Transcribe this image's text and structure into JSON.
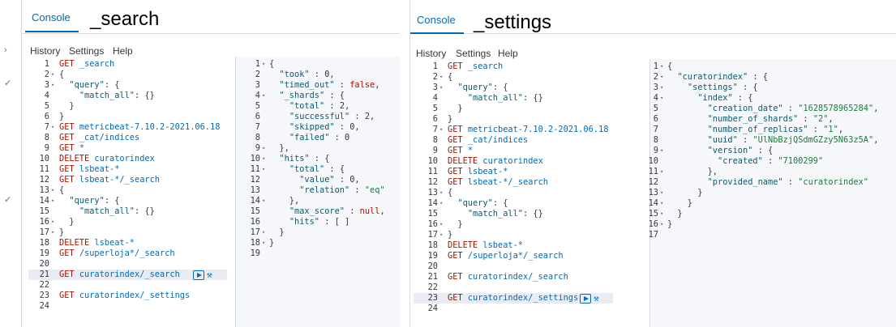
{
  "left": {
    "tab": "Console",
    "heading": "_search",
    "menu": [
      "History",
      "Settings",
      "Help"
    ],
    "request_lines": [
      [
        [
          "kw",
          "GET "
        ],
        [
          "path",
          "_search"
        ]
      ],
      [
        [
          "pun",
          "{"
        ]
      ],
      [
        [
          "pun",
          "  "
        ],
        [
          "key",
          "\"query\""
        ],
        [
          "pun",
          ": {"
        ]
      ],
      [
        [
          "pun",
          "    "
        ],
        [
          "key",
          "\"match_all\""
        ],
        [
          "pun",
          ": {}"
        ]
      ],
      [
        [
          "pun",
          "  }"
        ]
      ],
      [
        [
          "pun",
          "}"
        ]
      ],
      [
        [
          "kw",
          "GET "
        ],
        [
          "path",
          "metricbeat-7.10.2-2021.06.18"
        ]
      ],
      [
        [
          "kw",
          "GET "
        ],
        [
          "path",
          "_cat/indices"
        ]
      ],
      [
        [
          "kw",
          "GET "
        ],
        [
          "path",
          "*"
        ]
      ],
      [
        [
          "kw",
          "DELETE "
        ],
        [
          "path",
          "curatorindex"
        ]
      ],
      [
        [
          "kw",
          "GET "
        ],
        [
          "path",
          "lsbeat-*"
        ]
      ],
      [
        [
          "kw",
          "GET "
        ],
        [
          "path",
          "lsbeat-*/_search"
        ]
      ],
      [
        [
          "pun",
          "{"
        ]
      ],
      [
        [
          "pun",
          "  "
        ],
        [
          "key",
          "\"query\""
        ],
        [
          "pun",
          ": {"
        ]
      ],
      [
        [
          "pun",
          "    "
        ],
        [
          "key",
          "\"match_all\""
        ],
        [
          "pun",
          ": {}"
        ]
      ],
      [
        [
          "pun",
          "  }"
        ]
      ],
      [
        [
          "pun",
          "}"
        ]
      ],
      [
        [
          "kw",
          "DELETE "
        ],
        [
          "path",
          "lsbeat-*"
        ]
      ],
      [
        [
          "kw",
          "GET "
        ],
        [
          "path",
          "/superloja*/_search"
        ]
      ],
      [],
      [
        [
          "kw",
          "GET "
        ],
        [
          "path",
          "curatorindex/_search"
        ]
      ],
      [],
      [
        [
          "kw",
          "GET "
        ],
        [
          "path",
          "curatorindex/_settings"
        ]
      ],
      []
    ],
    "request_folds": [
      2,
      3,
      7,
      13,
      14,
      16,
      17
    ],
    "response_lines": [
      [
        [
          "pun",
          "{"
        ]
      ],
      [
        [
          "pun",
          "  "
        ],
        [
          "key",
          "\"took\""
        ],
        [
          "pun",
          " : "
        ],
        [
          "num",
          "0"
        ],
        [
          "pun",
          ","
        ]
      ],
      [
        [
          "pun",
          "  "
        ],
        [
          "key",
          "\"timed_out\""
        ],
        [
          "pun",
          " : "
        ],
        [
          "bool",
          "false"
        ],
        [
          "pun",
          ","
        ]
      ],
      [
        [
          "pun",
          "  "
        ],
        [
          "key",
          "\"_shards\""
        ],
        [
          "pun",
          " : {"
        ]
      ],
      [
        [
          "pun",
          "    "
        ],
        [
          "key",
          "\"total\""
        ],
        [
          "pun",
          " : "
        ],
        [
          "num",
          "2"
        ],
        [
          "pun",
          ","
        ]
      ],
      [
        [
          "pun",
          "    "
        ],
        [
          "key",
          "\"successful\""
        ],
        [
          "pun",
          " : "
        ],
        [
          "num",
          "2"
        ],
        [
          "pun",
          ","
        ]
      ],
      [
        [
          "pun",
          "    "
        ],
        [
          "key",
          "\"skipped\""
        ],
        [
          "pun",
          " : "
        ],
        [
          "num",
          "0"
        ],
        [
          "pun",
          ","
        ]
      ],
      [
        [
          "pun",
          "    "
        ],
        [
          "key",
          "\"failed\""
        ],
        [
          "pun",
          " : "
        ],
        [
          "num",
          "0"
        ]
      ],
      [
        [
          "pun",
          "  },"
        ]
      ],
      [
        [
          "pun",
          "  "
        ],
        [
          "key",
          "\"hits\""
        ],
        [
          "pun",
          " : {"
        ]
      ],
      [
        [
          "pun",
          "    "
        ],
        [
          "key",
          "\"total\""
        ],
        [
          "pun",
          " : {"
        ]
      ],
      [
        [
          "pun",
          "      "
        ],
        [
          "key",
          "\"value\""
        ],
        [
          "pun",
          " : "
        ],
        [
          "num",
          "0"
        ],
        [
          "pun",
          ","
        ]
      ],
      [
        [
          "pun",
          "      "
        ],
        [
          "key",
          "\"relation\""
        ],
        [
          "pun",
          " : "
        ],
        [
          "str",
          "\"eq\""
        ]
      ],
      [
        [
          "pun",
          "    },"
        ]
      ],
      [
        [
          "pun",
          "    "
        ],
        [
          "key",
          "\"max_score\""
        ],
        [
          "pun",
          " : "
        ],
        [
          "bool",
          "null"
        ],
        [
          "pun",
          ","
        ]
      ],
      [
        [
          "pun",
          "    "
        ],
        [
          "key",
          "\"hits\""
        ],
        [
          "pun",
          " : [ ]"
        ]
      ],
      [
        [
          "pun",
          "  }"
        ]
      ],
      [
        [
          "pun",
          "}"
        ]
      ],
      []
    ],
    "response_folds": [
      1,
      4,
      9,
      10,
      11,
      14,
      17,
      18
    ],
    "active_line": 21
  },
  "right": {
    "tab": "Console",
    "heading": "_settings",
    "menu": [
      "History",
      "Settings",
      "Help"
    ],
    "request_lines": [
      [
        [
          "kw",
          "GET "
        ],
        [
          "path",
          "_search"
        ]
      ],
      [
        [
          "pun",
          "{"
        ]
      ],
      [
        [
          "pun",
          "  "
        ],
        [
          "key",
          "\"query\""
        ],
        [
          "pun",
          ": {"
        ]
      ],
      [
        [
          "pun",
          "    "
        ],
        [
          "key",
          "\"match_all\""
        ],
        [
          "pun",
          ": {}"
        ]
      ],
      [
        [
          "pun",
          "  }"
        ]
      ],
      [
        [
          "pun",
          "}"
        ]
      ],
      [
        [
          "kw",
          "GET "
        ],
        [
          "path",
          "metricbeat-7.10.2-2021.06.18"
        ]
      ],
      [
        [
          "kw",
          "GET "
        ],
        [
          "path",
          "_cat/indices"
        ]
      ],
      [
        [
          "kw",
          "GET "
        ],
        [
          "path",
          "*"
        ]
      ],
      [
        [
          "kw",
          "DELETE "
        ],
        [
          "path",
          "curatorindex"
        ]
      ],
      [
        [
          "kw",
          "GET "
        ],
        [
          "path",
          "lsbeat-*"
        ]
      ],
      [
        [
          "kw",
          "GET "
        ],
        [
          "path",
          "lsbeat-*/_search"
        ]
      ],
      [
        [
          "pun",
          "{"
        ]
      ],
      [
        [
          "pun",
          "  "
        ],
        [
          "key",
          "\"query\""
        ],
        [
          "pun",
          ": {"
        ]
      ],
      [
        [
          "pun",
          "    "
        ],
        [
          "key",
          "\"match_all\""
        ],
        [
          "pun",
          ": {}"
        ]
      ],
      [
        [
          "pun",
          "  }"
        ]
      ],
      [
        [
          "pun",
          "}"
        ]
      ],
      [
        [
          "kw",
          "DELETE "
        ],
        [
          "path",
          "lsbeat-*"
        ]
      ],
      [
        [
          "kw",
          "GET "
        ],
        [
          "path",
          "/superloja*/_search"
        ]
      ],
      [],
      [
        [
          "kw",
          "GET "
        ],
        [
          "path",
          "curatorindex/_search"
        ]
      ],
      [],
      [
        [
          "kw",
          "GET "
        ],
        [
          "path",
          "curatorindex/_settings"
        ]
      ],
      []
    ],
    "request_folds": [
      2,
      3,
      7,
      13,
      14,
      16,
      17
    ],
    "response_lines": [
      [
        [
          "pun",
          "{"
        ]
      ],
      [
        [
          "pun",
          "  "
        ],
        [
          "key",
          "\"curatorindex\""
        ],
        [
          "pun",
          " : {"
        ]
      ],
      [
        [
          "pun",
          "    "
        ],
        [
          "key",
          "\"settings\""
        ],
        [
          "pun",
          " : {"
        ]
      ],
      [
        [
          "pun",
          "      "
        ],
        [
          "key",
          "\"index\""
        ],
        [
          "pun",
          " : {"
        ]
      ],
      [
        [
          "pun",
          "        "
        ],
        [
          "key",
          "\"creation_date\""
        ],
        [
          "pun",
          " : "
        ],
        [
          "str",
          "\"1628578965284\""
        ],
        [
          "pun",
          ","
        ]
      ],
      [
        [
          "pun",
          "        "
        ],
        [
          "key",
          "\"number_of_shards\""
        ],
        [
          "pun",
          " : "
        ],
        [
          "str",
          "\"2\""
        ],
        [
          "pun",
          ","
        ]
      ],
      [
        [
          "pun",
          "        "
        ],
        [
          "key",
          "\"number_of_replicas\""
        ],
        [
          "pun",
          " : "
        ],
        [
          "str",
          "\"1\""
        ],
        [
          "pun",
          ","
        ]
      ],
      [
        [
          "pun",
          "        "
        ],
        [
          "key",
          "\"uuid\""
        ],
        [
          "pun",
          " : "
        ],
        [
          "str",
          "\"UlNbBzjQSdmGZzy5N63z5A\""
        ],
        [
          "pun",
          ","
        ]
      ],
      [
        [
          "pun",
          "        "
        ],
        [
          "key",
          "\"version\""
        ],
        [
          "pun",
          " : {"
        ]
      ],
      [
        [
          "pun",
          "          "
        ],
        [
          "key",
          "\"created\""
        ],
        [
          "pun",
          " : "
        ],
        [
          "str",
          "\"7100299\""
        ]
      ],
      [
        [
          "pun",
          "        },"
        ]
      ],
      [
        [
          "pun",
          "        "
        ],
        [
          "key",
          "\"provided_name\""
        ],
        [
          "pun",
          " : "
        ],
        [
          "str",
          "\"curatorindex\""
        ]
      ],
      [
        [
          "pun",
          "      }"
        ]
      ],
      [
        [
          "pun",
          "    }"
        ]
      ],
      [
        [
          "pun",
          "  }"
        ]
      ],
      [
        [
          "pun",
          "}"
        ]
      ],
      []
    ],
    "response_folds": [
      1,
      2,
      3,
      4,
      9,
      11,
      13,
      14,
      15,
      16
    ],
    "active_line": 23
  }
}
